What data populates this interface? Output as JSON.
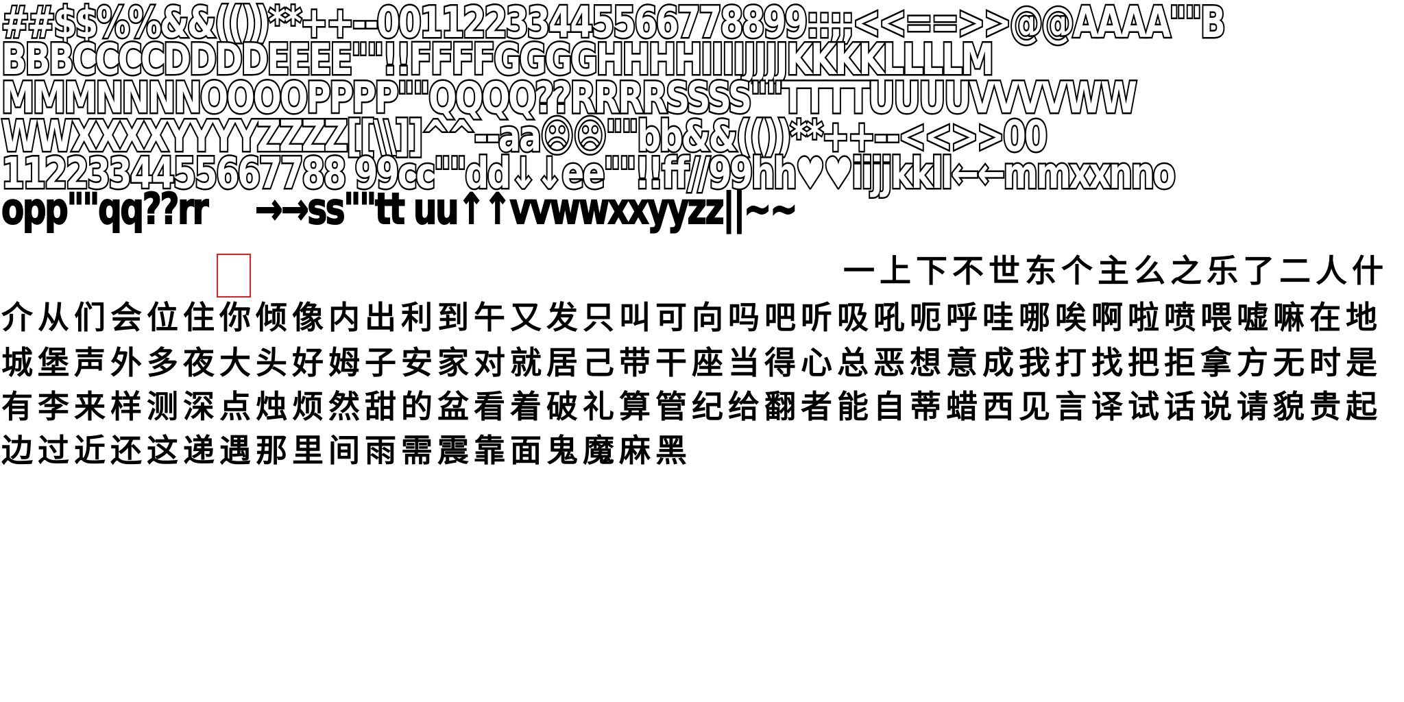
{
  "colors": {
    "ink": "#000000",
    "paper": "#ffffff",
    "marker": "#e0201c"
  },
  "atlas": {
    "latin_rows": [
      "##$$%%&&(())**++--00112233445566778899::;;<<==>>@@AAAA\"\"B",
      "BBBCCCCDDDDEEEE\"\"!!FFFFGGGGHHHHIIIIJJJJKKKKLLLLM",
      "MMMNNNNOOOOPPPP\"\"QQQQ??RRRRSSSS\"\"TTTTUUUUVVVVWW",
      "WWXXXXYYYYZZZZ[[\\\\]]^^--aa☹☹\"\"bb&&(())**++--<<>>00",
      "1122334455667788 99cc\"\"dd↓↓ee\"\"!!ff//99hh♥♥iijjkkll←←mmxxnno",
      "opp\"\"qq??rr"
    ],
    "latin_row6_tail": "→→ss\"\"tt uu↑↑vvwwxxyyzz||~~",
    "cjk_row6": "一上下不世东个主么之乐了二人什",
    "cjk_rows": [
      "介从们会位住你倾像内出利到午又发只叫可向吗吧听吸吼呃呼哇哪唉啊啦喷喂嘘嘛在地",
      "城堡声外多夜大头好姆子安家对就居己带干座当得心总恶想意成我打找把拒拿方无时是",
      "有李来样测深点烛烦然甜的盆看着破礼算管纪给翻者能自蒂蜡西见言译试话说请貌贵起",
      "边过近还这递遇那里间雨需震靠面鬼魔麻黑"
    ]
  }
}
